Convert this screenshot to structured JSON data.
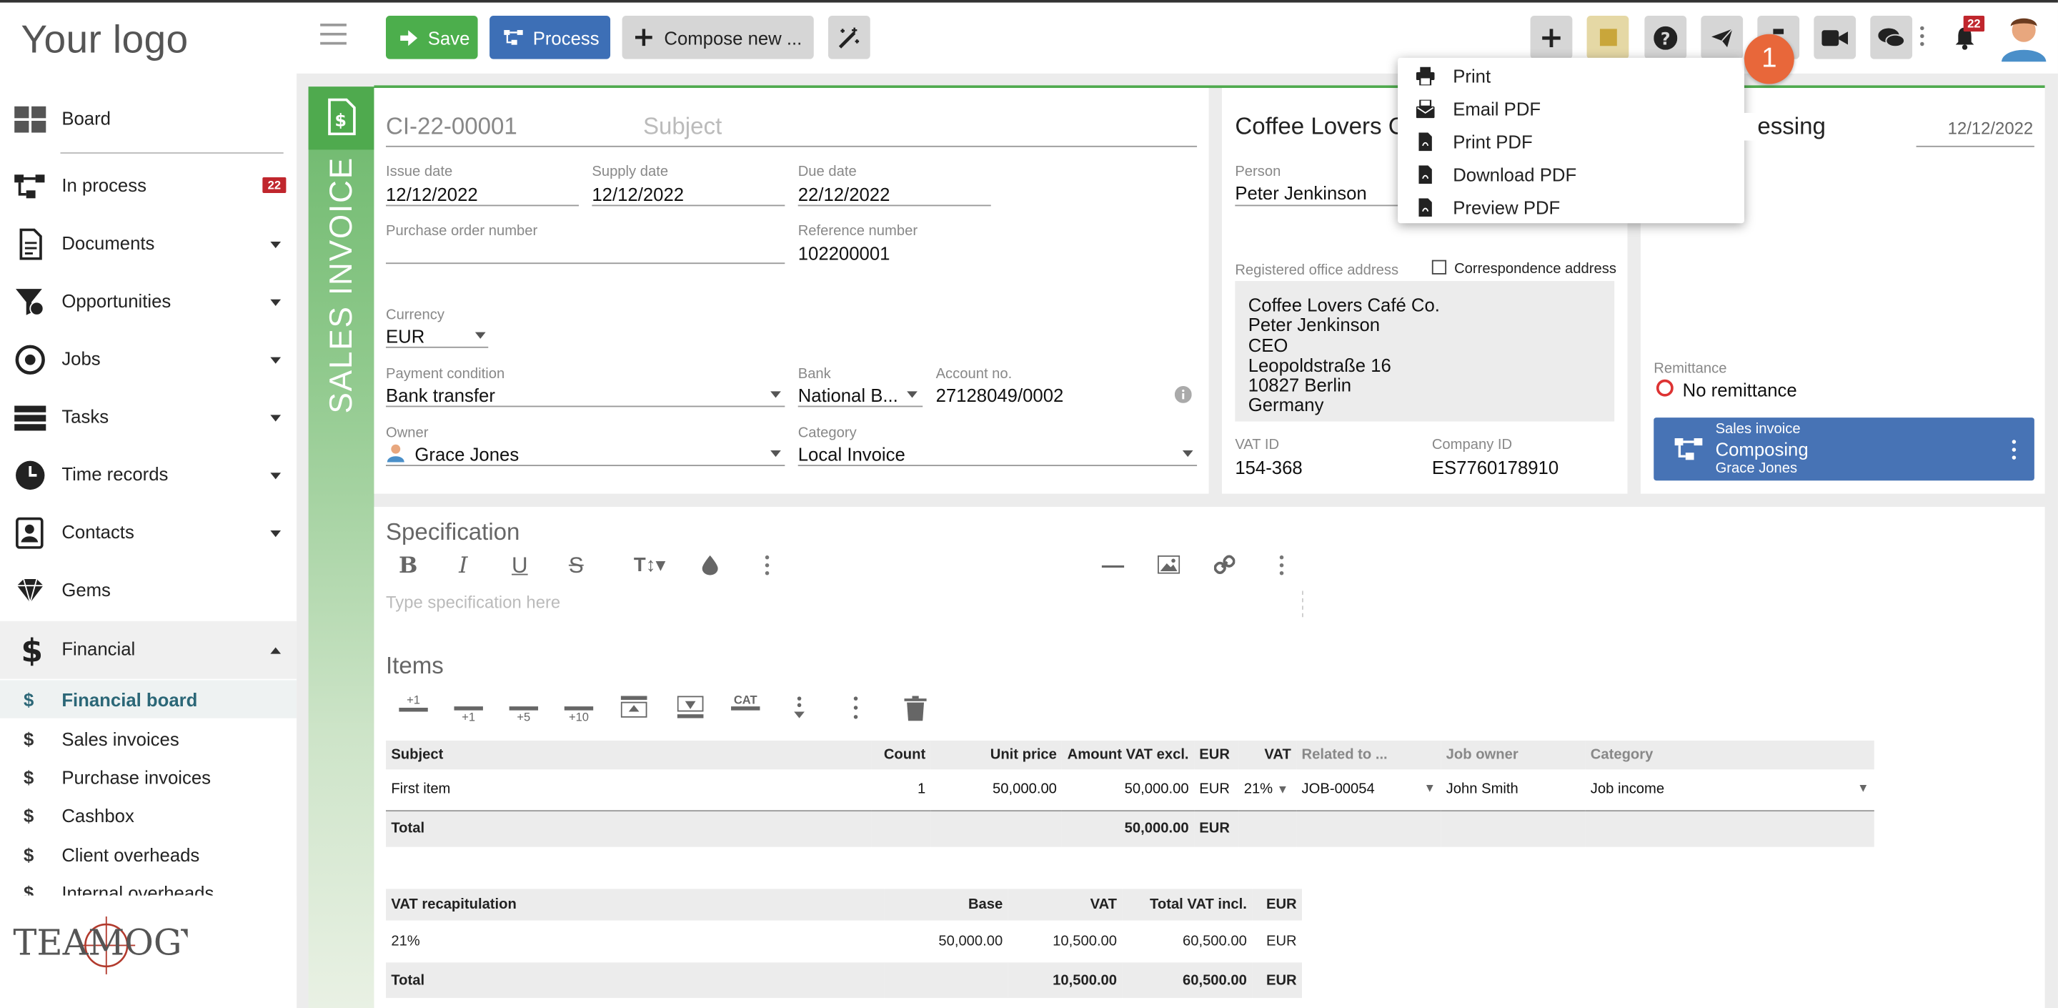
{
  "logo": "Your logo",
  "footer_brand": "TEAMOGY",
  "sidebar": {
    "items": [
      {
        "label": "Board"
      },
      {
        "label": "In process",
        "badge": "22"
      },
      {
        "label": "Documents"
      },
      {
        "label": "Opportunities"
      },
      {
        "label": "Jobs"
      },
      {
        "label": "Tasks"
      },
      {
        "label": "Time records"
      },
      {
        "label": "Contacts"
      },
      {
        "label": "Gems"
      },
      {
        "label": "Financial"
      }
    ],
    "financial_sub": [
      {
        "label": "Financial board"
      },
      {
        "label": "Sales invoices"
      },
      {
        "label": "Purchase invoices"
      },
      {
        "label": "Cashbox"
      },
      {
        "label": "Client overheads"
      },
      {
        "label": "Internal overheads"
      }
    ]
  },
  "toolbar": {
    "save": "Save",
    "process": "Process",
    "compose": "Compose new ...",
    "notifications_badge": "22"
  },
  "menu": {
    "items": [
      "Print",
      "Email PDF",
      "Print PDF",
      "Download PDF",
      "Preview PDF"
    ],
    "step_marker": "1"
  },
  "document": {
    "type_label": "SALES INVOICE",
    "number": "CI-22-00001",
    "subject_placeholder": "Subject",
    "issue_date_label": "Issue date",
    "issue_date": "12/12/2022",
    "supply_date_label": "Supply date",
    "supply_date": "12/12/2022",
    "due_date_label": "Due date",
    "due_date": "22/12/2022",
    "po_label": "Purchase order number",
    "po_value": "",
    "ref_label": "Reference number",
    "ref_value": "102200001",
    "currency_label": "Currency",
    "currency": "EUR",
    "payment_label": "Payment condition",
    "payment": "Bank transfer",
    "bank_label": "Bank",
    "bank": "National B...",
    "account_label": "Account no.",
    "account": "27128049/0002",
    "owner_label": "Owner",
    "owner": "Grace Jones",
    "category_label": "Category",
    "category": "Local Invoice"
  },
  "client": {
    "name": "Coffee Lovers C",
    "person_label": "Person",
    "person": "Peter Jenkinson",
    "office_label": "Registered office address",
    "correspondence_label": "Correspondence address",
    "address": [
      "Coffee Lovers Café Co.",
      "Peter Jenkinson",
      "CEO",
      "Leopoldstraße 16",
      "10827 Berlin",
      "Germany"
    ],
    "vat_label": "VAT ID",
    "vat": "154-368",
    "company_label": "Company ID",
    "company": "ES7760178910"
  },
  "workflow": {
    "title": "essing",
    "date": "12/12/2022",
    "remittance_label": "Remittance",
    "remittance": "No remittance",
    "card_type": "Sales invoice",
    "card_state": "Composing",
    "card_person": "Grace Jones"
  },
  "specification": {
    "title": "Specification",
    "placeholder": "Type specification here"
  },
  "items": {
    "title": "Items",
    "toolbar_labels": [
      "+1",
      "+1",
      "+5",
      "+10",
      "CAT"
    ],
    "headers": [
      "Subject",
      "Count",
      "Unit price",
      "Amount VAT excl.",
      "EUR",
      "VAT",
      "Related to ...",
      "Job owner",
      "Category"
    ],
    "rows": [
      {
        "subject": "First item",
        "count": "1",
        "unit_price": "50,000.00",
        "amount": "50,000.00",
        "cur": "EUR",
        "vat": "21%",
        "related": "JOB-00054",
        "owner": "John Smith",
        "category": "Job income"
      }
    ],
    "total_label": "Total",
    "total_amount": "50,000.00",
    "total_cur": "EUR"
  },
  "vat_recap": {
    "headers": [
      "VAT recapitulation",
      "Base",
      "VAT",
      "Total VAT incl.",
      "EUR"
    ],
    "rows": [
      {
        "rate": "21%",
        "base": "50,000.00",
        "vat": "10,500.00",
        "total": "60,500.00",
        "cur": "EUR"
      }
    ],
    "total_label": "Total",
    "total_vat": "10,500.00",
    "total_incl": "60,500.00",
    "total_cur": "EUR"
  }
}
